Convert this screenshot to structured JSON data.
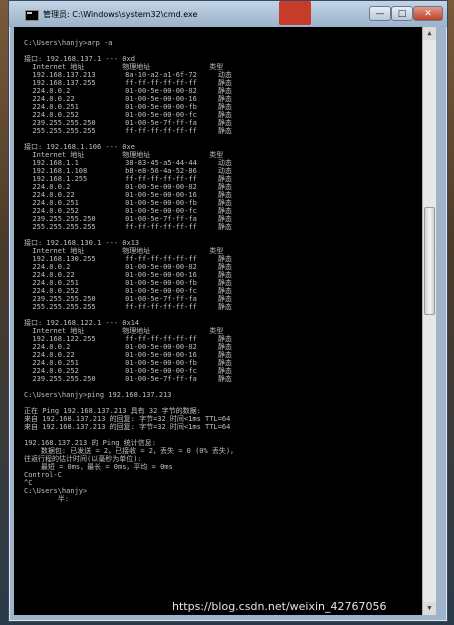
{
  "window": {
    "title": "管理员: C:\\Windows\\system32\\cmd.exe",
    "minimize": "—",
    "maximize": "□",
    "close": "✕"
  },
  "console_lines": [
    "",
    "C:\\Users\\hanjy>arp -a",
    "",
    "接口: 192.168.137.1 --- 0xd",
    "  Internet 地址         物理地址              类型",
    "  192.168.137.213       8a-10-a2-a1-6f-72     动态",
    "  192.168.137.255       ff-ff-ff-ff-ff-ff     静态",
    "  224.0.0.2             01-00-5e-00-00-02     静态",
    "  224.0.0.22            01-00-5e-00-00-16     静态",
    "  224.0.0.251           01-00-5e-00-00-fb     静态",
    "  224.0.0.252           01-00-5e-00-00-fc     静态",
    "  239.255.255.250       01-00-5e-7f-ff-fa     静态",
    "  255.255.255.255       ff-ff-ff-ff-ff-ff     静态",
    "",
    "接口: 192.168.1.106 --- 0xe",
    "  Internet 地址         物理地址              类型",
    "  192.168.1.1           38-83-45-a5-44-44     动态",
    "  192.168.1.108         b8-e8-56-4a-52-86     动态",
    "  192.168.1.255         ff-ff-ff-ff-ff-ff     静态",
    "  224.0.0.2             01-00-5e-00-00-02     静态",
    "  224.0.0.22            01-00-5e-00-00-16     静态",
    "  224.0.0.251           01-00-5e-00-00-fb     静态",
    "  224.0.0.252           01-00-5e-00-00-fc     静态",
    "  239.255.255.250       01-00-5e-7f-ff-fa     静态",
    "  255.255.255.255       ff-ff-ff-ff-ff-ff     静态",
    "",
    "接口: 192.168.130.1 --- 0x13",
    "  Internet 地址         物理地址              类型",
    "  192.168.130.255       ff-ff-ff-ff-ff-ff     静态",
    "  224.0.0.2             01-00-5e-00-00-02     静态",
    "  224.0.0.22            01-00-5e-00-00-16     静态",
    "  224.0.0.251           01-00-5e-00-00-fb     静态",
    "  224.0.0.252           01-00-5e-00-00-fc     静态",
    "  239.255.255.250       01-00-5e-7f-ff-fa     静态",
    "  255.255.255.255       ff-ff-ff-ff-ff-ff     静态",
    "",
    "接口: 192.168.122.1 --- 0x14",
    "  Internet 地址         物理地址              类型",
    "  192.168.122.255       ff-ff-ff-ff-ff-ff     静态",
    "  224.0.0.2             01-00-5e-00-00-02     静态",
    "  224.0.0.22            01-00-5e-00-00-16     静态",
    "  224.0.0.251           01-00-5e-00-00-fb     静态",
    "  224.0.0.252           01-00-5e-00-00-fc     静态",
    "  239.255.255.250       01-00-5e-7f-ff-fa     静态",
    "",
    "C:\\Users\\hanjy>ping 192.168.137.213",
    "",
    "正在 Ping 192.168.137.213 具有 32 字节的数据:",
    "来自 192.168.137.213 的回复: 字节=32 时间<1ms TTL=64",
    "来自 192.168.137.213 的回复: 字节=32 时间<1ms TTL=64",
    "",
    "192.168.137.213 的 Ping 统计信息:",
    "    数据包: 已发送 = 2，已接收 = 2，丢失 = 0 (0% 丢失)，",
    "往返行程的估计时间(以毫秒为单位):",
    "    最短 = 0ms，最长 = 0ms，平均 = 0ms",
    "Control-C",
    "^C",
    "C:\\Users\\hanjy>",
    "        半:"
  ],
  "scrollbar": {
    "up": "▲",
    "down": "▼"
  },
  "watermark": "https://blog.csdn.net/weixin_42767056"
}
